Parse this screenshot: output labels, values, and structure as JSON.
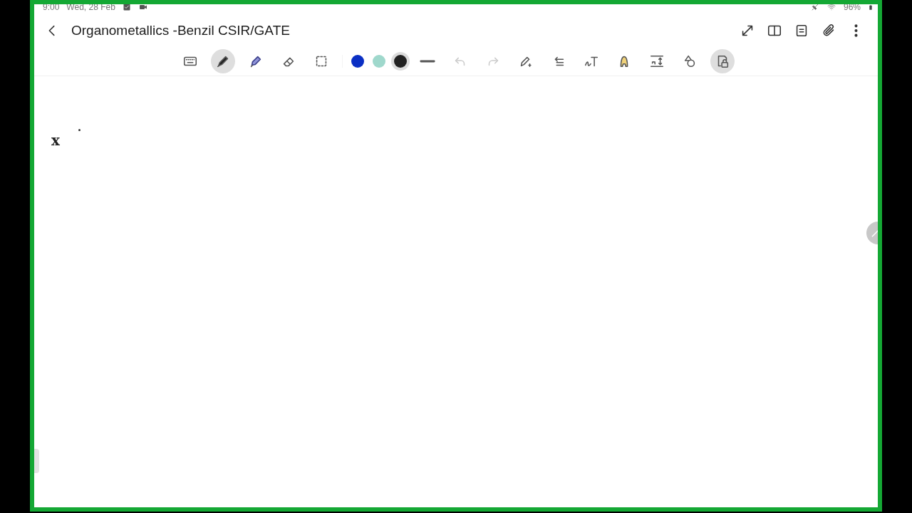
{
  "status_bar": {
    "time": "9:00",
    "date": "Wed, 28 Feb",
    "battery": "96%"
  },
  "header": {
    "title": "Organometallics -Benzil CSIR/GATE"
  },
  "toolbar": {
    "tools": [
      {
        "kind": "keyboard",
        "selected": false
      },
      {
        "kind": "pen",
        "selected": true
      },
      {
        "kind": "highlighter",
        "selected": false
      },
      {
        "kind": "eraser",
        "selected": false
      },
      {
        "kind": "selection",
        "selected": false
      }
    ],
    "colors": [
      {
        "color": "#0a2fc4",
        "selected": false
      },
      {
        "color": "#9fd8cc",
        "selected": false
      },
      {
        "color": "#222222",
        "selected": true
      }
    ],
    "actions": [
      {
        "kind": "thickness",
        "disabled": false,
        "on": false
      },
      {
        "kind": "undo",
        "disabled": true,
        "on": false
      },
      {
        "kind": "redo",
        "disabled": true,
        "on": false
      },
      {
        "kind": "pen-settings",
        "disabled": false,
        "on": false
      },
      {
        "kind": "align",
        "disabled": false,
        "on": false
      },
      {
        "kind": "handwriting",
        "disabled": false,
        "on": false
      },
      {
        "kind": "text-color",
        "disabled": false,
        "on": false
      },
      {
        "kind": "spacing",
        "disabled": false,
        "on": false
      },
      {
        "kind": "shapes",
        "disabled": false,
        "on": false
      },
      {
        "kind": "lock",
        "disabled": false,
        "on": true
      }
    ]
  },
  "canvas": {
    "handwriting": "x"
  }
}
